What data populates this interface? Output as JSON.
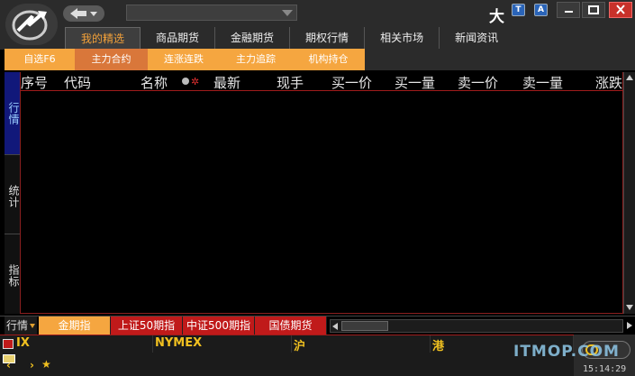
{
  "toolbar": {
    "search_value": "",
    "font_size_label": "大",
    "icon_t_label": "T",
    "icon_a_label": "A"
  },
  "main_tabs": [
    {
      "label": "我的精选",
      "active": true
    },
    {
      "label": "商品期货"
    },
    {
      "label": "金融期货"
    },
    {
      "label": "期权行情"
    },
    {
      "label": "相关市场"
    },
    {
      "label": "新闻资讯"
    }
  ],
  "sub_tabs": [
    {
      "label": "自选F6"
    },
    {
      "label": "主力合约",
      "active": true
    },
    {
      "label": "连涨连跌"
    },
    {
      "label": "主力追踪"
    },
    {
      "label": "机构持仓"
    }
  ],
  "side_tabs": {
    "hangqing": "行情",
    "tongji": "统计",
    "zhibiao": "指标"
  },
  "columns": [
    "序号",
    "代码",
    "名称",
    "最新",
    "现手",
    "买一价",
    "买一量",
    "卖一价",
    "卖一量",
    "涨跌"
  ],
  "bottom_tabs": {
    "hangqing": "行情",
    "items": [
      "金期指",
      "上证50期指",
      "中证500期指",
      "国债期货"
    ]
  },
  "ticker": {
    "ix": "IX",
    "nymex": "NYMEX",
    "hu": "沪",
    "gang": "港"
  },
  "status": {
    "watermark": "ITMOP.COM",
    "time": "15:14:29"
  },
  "colors": {
    "accent": "#f5a640",
    "header_red": "#a01b1b",
    "tab_red": "#c01a1a"
  }
}
